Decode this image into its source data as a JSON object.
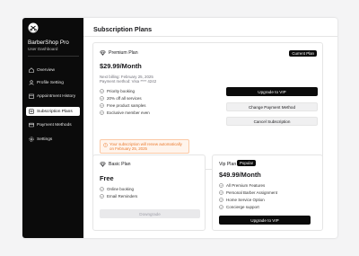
{
  "sidebar": {
    "brand": "BarberShop Pro",
    "subtitle": "User Dashboard",
    "items": [
      {
        "label": "Overview",
        "icon": "home-icon"
      },
      {
        "label": "Profile Setting",
        "icon": "user-icon"
      },
      {
        "label": "Appointment History",
        "icon": "calendar-icon"
      },
      {
        "label": "Subscription Plans",
        "icon": "subscription-icon",
        "active": true
      },
      {
        "label": "Payment Methods",
        "icon": "credit-card-icon"
      },
      {
        "label": "Settings",
        "icon": "gear-icon"
      }
    ]
  },
  "main": {
    "title": "Subscription Plans",
    "premium": {
      "name": "Premium Plan",
      "badge": "Current Plan",
      "price": "$29.99/Month",
      "next_billing": "Next billing: February 25, 2025",
      "payment_method": "Payment method: Visa **** 4242",
      "features": [
        "Priority booking",
        "20% off all services",
        "Free product samples",
        "Exclusive member even"
      ],
      "upgrade_label": "Upgrade to VIP",
      "change_payment_label": "Change Payment Method",
      "cancel_label": "Cancel Subscription",
      "notice": "Your subscription will renew automatically on February 25, 2025"
    },
    "basic": {
      "name": "Basic Plan",
      "price": "Free",
      "features": [
        "Online booking",
        "Email Reminders"
      ],
      "button_label": "Downgrade"
    },
    "vip": {
      "name": "Vip Plan",
      "badge": "Popular",
      "price": "$49.99/Month",
      "features": [
        "All Premium Features",
        "Personal Barber Assignment",
        "Home Service Option",
        "Concierge support"
      ],
      "button_label": "Upgrade to VIP"
    }
  },
  "colors": {
    "sidebar_bg": "#0b0b0b",
    "accent": "#0b0b0b",
    "notice_text": "#ea7a2e",
    "notice_bg": "#fff4ec"
  }
}
